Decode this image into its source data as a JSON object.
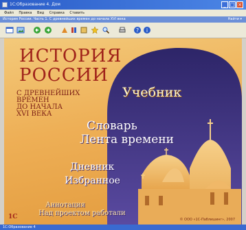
{
  "window": {
    "title": "1С:Образование 4. Дом",
    "minimize_glyph": "_",
    "maximize_glyph": "□",
    "close_glyph": "×"
  },
  "menu": {
    "items": [
      {
        "label": "Файл"
      },
      {
        "label": "Правка"
      },
      {
        "label": "Вид"
      },
      {
        "label": "Справка"
      },
      {
        "label": "Ставить"
      }
    ]
  },
  "pathbar": {
    "path": "История России. Часть 1. С древнейших времен до начала XVI века",
    "right": "Найти ▾"
  },
  "toolbar": {
    "icons": [
      "window-icon",
      "image-icon",
      "back-arrow-icon",
      "forward-arrow-icon",
      "refresh-icon",
      "home-icon",
      "library-icon",
      "book-icon",
      "favorite-star-icon",
      "search-icon",
      "print-icon",
      "help-icon",
      "info-icon"
    ]
  },
  "hero": {
    "title_line1": "ИСТОРИЯ",
    "title_line2": "РОССИИ",
    "subtitle_line1": "С ДРЕВНЕЙШИХ",
    "subtitle_line2": "ВРЕМЕН",
    "subtitle_line3": "ДО НАЧАЛА",
    "subtitle_line4": "XVI ВЕКА"
  },
  "nav": {
    "textbook": "Учебник",
    "dictionary": "Словарь",
    "timeline": "Лента времени",
    "diary": "Дневник",
    "favorites": "Избранное",
    "annotation": "Аннотация",
    "credits": "Над проектом работали"
  },
  "footer": {
    "logo": "1С",
    "copyright": "© ООО «1С-Паблишинг», 2007"
  },
  "statusbar": {
    "text": "1С:Образование 4"
  },
  "colors": {
    "title_red": "#a0231a",
    "bg_orange": "#eeaf56",
    "sky_purple": "#3b2f7a"
  }
}
